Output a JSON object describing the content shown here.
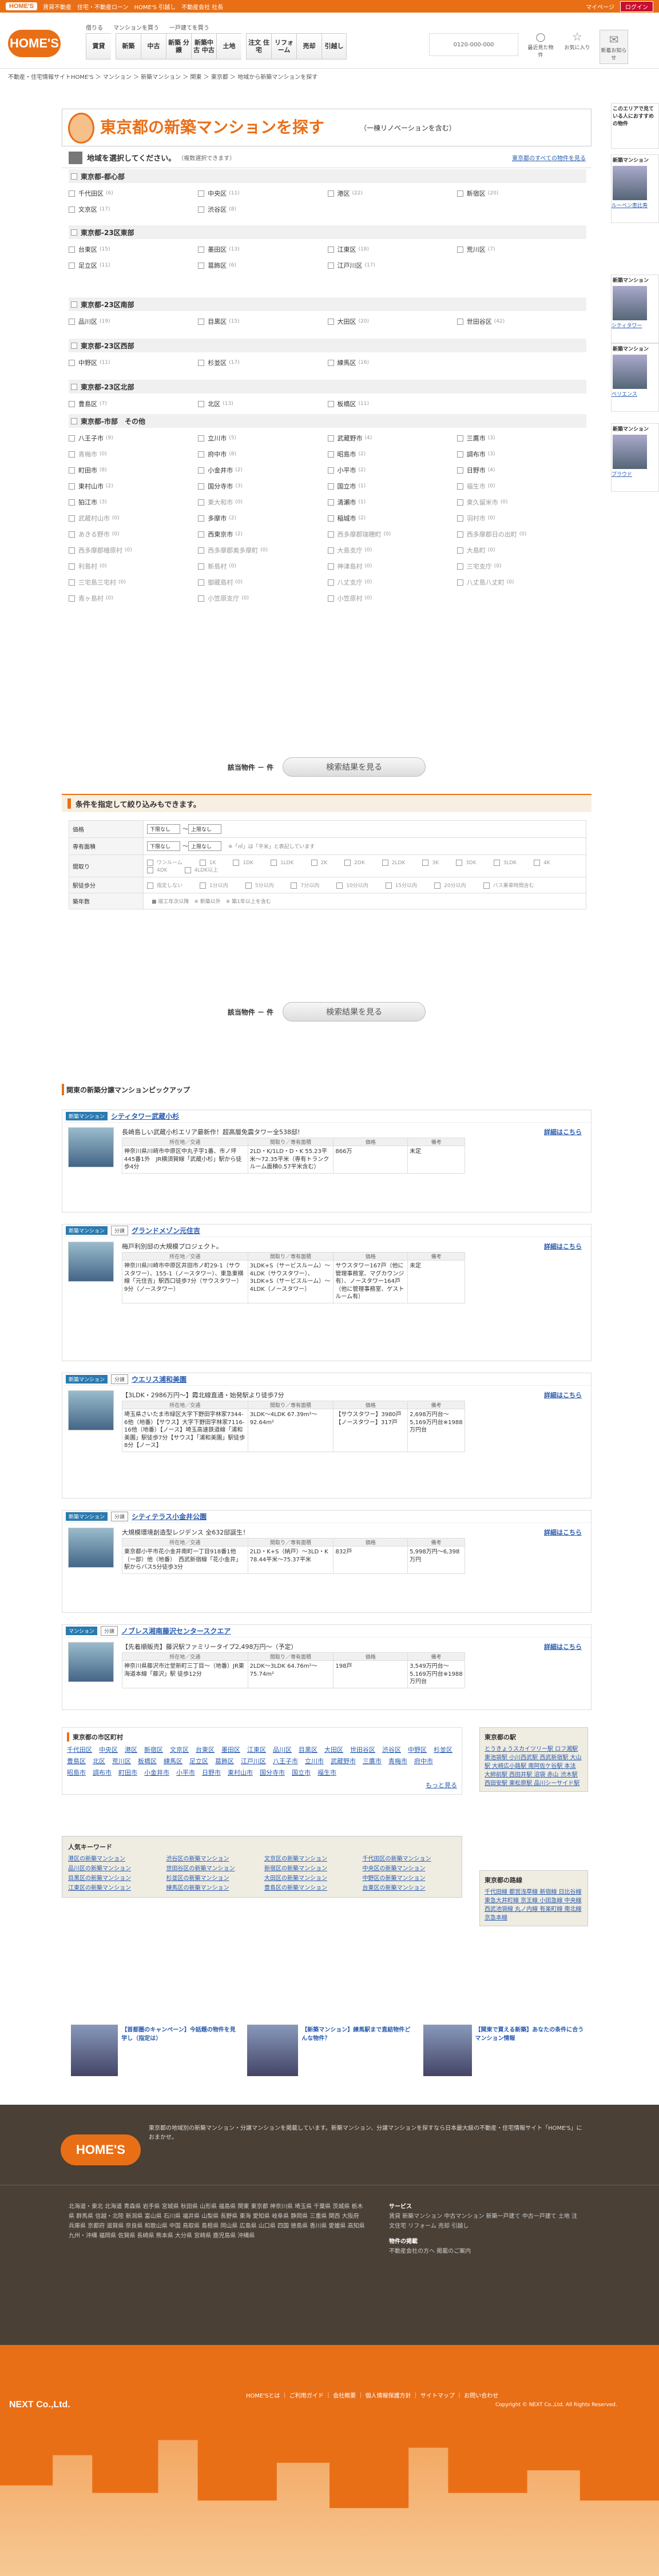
{
  "topbar": {
    "logo": "HOME'S",
    "link1": "賃貸不動産",
    "link2": "住宅・不動産ローン",
    "link3": "HOME'S 引越し",
    "link4": "不動産会社 社長",
    "right1": "マイページ",
    "right2": "ログイン"
  },
  "nav": {
    "caption1": "借りる",
    "caption2": "マンションを買う",
    "caption3": "一戸建てを買う",
    "items": [
      "賃貸",
      "新築",
      "中古",
      "新築 分譲",
      "新築中古 中古",
      "土地",
      "注文 住宅",
      "リフォーム",
      "売却",
      "引越し"
    ]
  },
  "header": {
    "phone": "0120-000-000",
    "icons": [
      {
        "name": "最近見た物件",
        "glyph": "○"
      },
      {
        "name": "お気に入り",
        "glyph": "☆"
      },
      {
        "name": "新着お知らせ",
        "glyph": "✉"
      }
    ]
  },
  "breadcrumb": "不動産・住宅情報サイトHOME'S ＞ マンション ＞ 新築マンション ＞ 関東 ＞ 東京都 ＞ 地域から新築マンションを探す",
  "title": {
    "main": "東京都の新築マンションを探す",
    "sub": "（一棟リノベーションを含む）"
  },
  "region": {
    "title": "地域を選択してください。",
    "note": "（複数選択できます）",
    "link": "東京都のすべての物件を見る"
  },
  "sections": [
    {
      "name": "東京都-都心部",
      "items": [
        {
          "n": "千代田区",
          "c": "(6)"
        },
        {
          "n": "中央区",
          "c": "(11)"
        },
        {
          "n": "港区",
          "c": "(22)"
        },
        {
          "n": "新宿区",
          "c": "(20)"
        },
        {
          "n": "文京区",
          "c": "(17)"
        },
        {
          "n": "渋谷区",
          "c": "(8)"
        }
      ]
    },
    {
      "name": "東京都-23区東部",
      "items": [
        {
          "n": "台東区",
          "c": "(15)"
        },
        {
          "n": "墨田区",
          "c": "(13)"
        },
        {
          "n": "江東区",
          "c": "(18)"
        },
        {
          "n": "荒川区",
          "c": "(7)"
        },
        {
          "n": "足立区",
          "c": "(11)"
        },
        {
          "n": "葛飾区",
          "c": "(6)"
        },
        {
          "n": "江戸川区",
          "c": "(17)"
        }
      ]
    },
    {
      "name": "東京都-23区南部",
      "items": [
        {
          "n": "品川区",
          "c": "(19)"
        },
        {
          "n": "目黒区",
          "c": "(15)"
        },
        {
          "n": "大田区",
          "c": "(20)"
        },
        {
          "n": "世田谷区",
          "c": "(42)"
        }
      ]
    },
    {
      "name": "東京都-23区西部",
      "items": [
        {
          "n": "中野区",
          "c": "(11)"
        },
        {
          "n": "杉並区",
          "c": "(17)"
        },
        {
          "n": "練馬区",
          "c": "(16)"
        }
      ]
    },
    {
      "name": "東京都-23区北部",
      "items": [
        {
          "n": "豊島区",
          "c": "(7)"
        },
        {
          "n": "北区",
          "c": "(13)"
        },
        {
          "n": "板橋区",
          "c": "(11)"
        }
      ]
    },
    {
      "name": "東京都-市部　その他",
      "items": [
        {
          "n": "八王子市",
          "c": "(9)"
        },
        {
          "n": "立川市",
          "c": "(5)"
        },
        {
          "n": "武蔵野市",
          "c": "(4)"
        },
        {
          "n": "三鷹市",
          "c": "(3)"
        },
        {
          "n": "青梅市",
          "c": "(0)",
          "d": 1
        },
        {
          "n": "府中市",
          "c": "(8)"
        },
        {
          "n": "昭島市",
          "c": "(2)"
        },
        {
          "n": "調布市",
          "c": "(3)"
        },
        {
          "n": "町田市",
          "c": "(8)"
        },
        {
          "n": "小金井市",
          "c": "(2)"
        },
        {
          "n": "小平市",
          "c": "(2)"
        },
        {
          "n": "日野市",
          "c": "(4)"
        },
        {
          "n": "東村山市",
          "c": "(2)"
        },
        {
          "n": "国分寺市",
          "c": "(3)"
        },
        {
          "n": "国立市",
          "c": "(1)"
        },
        {
          "n": "福生市",
          "c": "(0)",
          "d": 1
        },
        {
          "n": "狛江市",
          "c": "(3)"
        },
        {
          "n": "東大和市",
          "c": "(0)",
          "d": 1
        },
        {
          "n": "清瀬市",
          "c": "(1)"
        },
        {
          "n": "東久留米市",
          "c": "(0)",
          "d": 1
        },
        {
          "n": "武蔵村山市",
          "c": "(0)",
          "d": 1
        },
        {
          "n": "多摩市",
          "c": "(2)"
        },
        {
          "n": "稲城市",
          "c": "(2)"
        },
        {
          "n": "羽村市",
          "c": "(0)",
          "d": 1
        },
        {
          "n": "あきる野市",
          "c": "(0)",
          "d": 1
        },
        {
          "n": "西東京市",
          "c": "(2)"
        },
        {
          "n": "西多摩郡瑞穂町",
          "c": "(0)",
          "d": 1
        },
        {
          "n": "西多摩郡日の出町",
          "c": "(0)",
          "d": 1
        },
        {
          "n": "西多摩郡檜原村",
          "c": "(0)",
          "d": 1
        },
        {
          "n": "西多摩郡奥多摩町",
          "c": "(0)",
          "d": 1
        },
        {
          "n": "大島支庁",
          "c": "(0)",
          "d": 1
        },
        {
          "n": "大島町",
          "c": "(0)",
          "d": 1
        },
        {
          "n": "利島村",
          "c": "(0)",
          "d": 1
        },
        {
          "n": "新島村",
          "c": "(0)",
          "d": 1
        },
        {
          "n": "神津島村",
          "c": "(0)",
          "d": 1
        },
        {
          "n": "三宅支庁",
          "c": "(0)",
          "d": 1
        },
        {
          "n": "三宅島三宅村",
          "c": "(0)",
          "d": 1
        },
        {
          "n": "御蔵島村",
          "c": "(0)",
          "d": 1
        },
        {
          "n": "八丈支庁",
          "c": "(0)",
          "d": 1
        },
        {
          "n": "八丈島八丈町",
          "c": "(0)",
          "d": 1
        },
        {
          "n": "青ヶ島村",
          "c": "(0)",
          "d": 1
        },
        {
          "n": "小笠原支庁",
          "c": "(0)",
          "d": 1
        },
        {
          "n": "小笠原村",
          "c": "(0)",
          "d": 1
        }
      ]
    }
  ],
  "result": {
    "label": "該当物件 － 件",
    "button": "検索結果を見る"
  },
  "conditions": {
    "title": "条件を指定して絞り込みもできます。",
    "rows": [
      {
        "k": "価格",
        "v": [
          "下限なし",
          "〜",
          "上限なし"
        ]
      },
      {
        "k": "専有面積",
        "v": [
          "下限なし",
          "〜",
          "上限なし"
        ],
        "note": "※「㎡」は「平米」と表記しています"
      },
      {
        "k": "間取り",
        "opts": [
          "ワンルーム",
          "1K",
          "1DK",
          "1LDK",
          "2K",
          "2DK",
          "2LDK",
          "3K",
          "3DK",
          "3LDK",
          "4K",
          "4DK",
          "4LDK以上"
        ]
      },
      {
        "k": "駅徒歩分",
        "opts": [
          "指定しない",
          "1分以内",
          "5分以内",
          "7分以内",
          "10分以内",
          "15分以内",
          "20分以内",
          "バス乗車時間含む"
        ]
      },
      {
        "k": "築年数",
        "note": "■ 竣工年次以降　※ 新築以外　※ 築1年以上を含む"
      }
    ]
  },
  "pickup": {
    "title": "関東の新築分譲マンションピックアップ",
    "headers": [
      "所在地／交通",
      "間取り／専有面積",
      "価格",
      "備考"
    ],
    "more": "詳細はこちら",
    "cards": [
      {
        "tags": [
          "新築マンション"
        ],
        "name": "シティタワー武蔵小杉",
        "catch": "長崎島しい武蔵小杉エリア最新作！超高層免震タワー全538邸!",
        "addr": "神奈川県川崎市中原区中丸子字1番、市ノ坪445番1外　JR横須賀線「武蔵小杉」駅から徒歩4分",
        "plan": "2LD・K/1LD・D・K 55.23平米〜72.35平米（専有トランクルーム面積0.57平米含む）",
        "price": "866万",
        "note": "未定"
      },
      {
        "tags": [
          "新築マンション",
          "分譲"
        ],
        "name": "グランドメゾン元住吉",
        "catch": "梅戸利別邸の大規模プロジェクト。",
        "addr": "神奈川県川崎市中原区井田市ノ町29-1（サウスタワー）、155-1（ノースタワー）、東急東横線「元住吉」駅西口徒歩7分（サウスタワー）9分（ノースタワー）",
        "plan": "3LDK+S（サービスルーム）〜4LDK（サウスタワー）、3LDK+S（サービスルーム）〜4LDK（ノースタワー）",
        "price": "サウスタワー167戸（他に管理事務室、マグカウンジ有）、ノースタワー164戸（他に管理事務室、ゲストルーム有）",
        "note": "未定"
      },
      {
        "tags": [
          "新築マンション",
          "分譲"
        ],
        "name": "ウエリス浦和美園",
        "catch": "【3LDK・2986万円〜】霞北線直通・始発駅より徒歩7分",
        "addr": "埼玉県さいたま市緑区大字下野田字林家7344-6他（地番）【サウス】大字下野田字林家7116-16他（地番）【ノース】埼玉高速鉄道線「浦和美園」駅徒歩7分【サウス】「浦和美園」駅徒歩8分【ノース】",
        "plan": "3LDK〜4LDK 67.39m²〜92.64m²",
        "price": "【サウスタワー】3980戸【ノースタワー】317戸",
        "note": "2,698万円台〜5,169万円台※1988万円台"
      },
      {
        "tags": [
          "新築マンション",
          "分譲"
        ],
        "name": "シティテラス小金井公園",
        "catch": "大規模環境創造型レジデンス 全632邸誕生！",
        "addr": "東京都小平市花小金井南町一丁目918番1他（一部）他（地番）　西武新宿線「花小金井」駅からバス5分徒歩3分",
        "plan": "2LD・K+S（納戸）〜3LD・K 78.44平米〜75.37平米",
        "price": "832戸",
        "note": "5,998万円〜6,398万円"
      },
      {
        "tags": [
          "マンション",
          "分譲"
        ],
        "name": "ノブレス湘南藤沢センタースクエア",
        "catch": "【先着順販売】藤沢駅ファミリータイプ2,498万円〜（予定）",
        "addr": "神奈川県藤沢市辻堂新町三丁目〜（地番）JR東海道本線「藤沢」駅 徒歩12分",
        "plan": "2LDK〜3LDK 64.76m²〜75.74m²",
        "price": "198戸",
        "note": "3,549万円台〜5,169万円台※1988万円台"
      }
    ]
  },
  "areas": {
    "title": "東京都の市区町村",
    "items": [
      "千代田区",
      "中央区",
      "港区",
      "新宿区",
      "文京区",
      "台東区",
      "墨田区",
      "江東区",
      "品川区",
      "目黒区",
      "大田区",
      "世田谷区",
      "渋谷区",
      "中野区",
      "杉並区",
      "豊島区",
      "北区",
      "荒川区",
      "板橋区",
      "練馬区",
      "足立区",
      "葛飾区",
      "江戸川区",
      "八王子市",
      "立川市",
      "武蔵野市",
      "三鷹市",
      "青梅市",
      "府中市",
      "昭島市",
      "調布市",
      "町田市",
      "小金井市",
      "小平市",
      "日野市",
      "東村山市",
      "国分寺市",
      "国立市",
      "福生市"
    ],
    "more": "もっと見る"
  },
  "keywords": {
    "title": "人気キーワード",
    "items": [
      "港区の新築マンション",
      "渋谷区の新築マンション",
      "文京区の新築マンション",
      "千代田区の新築マンション",
      "品川区の新築マンション",
      "世田谷区の新築マンション",
      "新宿区の新築マンション",
      "中央区の新築マンション",
      "目黒区の新築マンション",
      "杉並区の新築マンション",
      "大田区の新築マンション",
      "中野区の新築マンション",
      "江東区の新築マンション",
      "練馬区の新築マンション",
      "豊島区の新築マンション",
      "台東区の新築マンション"
    ]
  },
  "side": {
    "box1": {
      "title": "東京都の駅",
      "text": "とうきょうスカイツリー駅 ロフ湘駅 東池袋駅 小川西武駅 西武新宿駅 大山駅 大崎広小路駅 南阿佐ケ谷駅 本法 大師前駅 西田井駅 沼袋 赤山 渋木駅 西田安駅 東松原駅 品川シーサイド駅"
    },
    "box2": {
      "title": "東京都の路線",
      "text": "千代田線 都営浅草線 新宿線 日比谷線 東急大井町線 京王線 小田急線 中央線 西武池袋線 丸ノ内線 有楽町線 南北線 京急本線"
    }
  },
  "rightcol": [
    {
      "title": "このエリアで見ている人におすすめの物件"
    },
    {
      "title": "新築マンション",
      "name": "ルーベン恵比寿"
    },
    {
      "title": "新築マンション",
      "name": "シティタワー"
    },
    {
      "title": "新築マンション",
      "name": "ベリエンス"
    },
    {
      "title": "新築マンション",
      "name": "プラウド"
    }
  ],
  "banners": [
    {
      "text": "【首都圏のキャンペーン】今話題の物件を見学し（指定は）"
    },
    {
      "text": "【新築マンション】練馬駅まで直結物件どんな物件？"
    },
    {
      "text": "【関東で買える新築】あなたの条件に合うマンション情報"
    }
  ],
  "footer": {
    "logo": "HOME'S",
    "desc": "東京都の地域別の新築マンション・分譲マンションを掲載しています。新築マンション、分譲マンションを探すなら日本最大級の不動産・住宅情報サイト「HOME'S」におまかせ。",
    "links": "北海道・東北 北海道 青森県 岩手県 宮城県 秋田県 山形県 福島県 関東 東京都 神奈川県 埼玉県 千葉県 茨城県 栃木県 群馬県 信越・北陸 新潟県 富山県 石川県 福井県 山梨県 長野県 東海 愛知県 岐阜県 静岡県 三重県 関西 大阪府 兵庫県 京都府 滋賀県 奈良県 和歌山県 中国 鳥取県 島根県 岡山県 広島県 山口県 四国 徳島県 香川県 愛媛県 高知県 九州・沖縄 福岡県 佐賀県 長崎県 熊本県 大分県 宮崎県 鹿児島県 沖縄県",
    "svcTitle": "サービス",
    "svc": "賃貸 新築マンション 中古マンション 新築一戸建て 中古一戸建て 土地 注文住宅 リフォーム 売却 引越し",
    "biz": "物件の掲載",
    "biztxt": "不動産会社の方へ 掲載のご案内"
  },
  "bottom": {
    "company": "NEXT Co.,Ltd.",
    "links": "HOME'Sとは ｜ ご利用ガイド ｜ 会社概要 ｜ 個人情報保護方針 ｜ サイトマップ ｜ お問い合わせ",
    "copy": "Copyright © NEXT Co.,Ltd. All Rights Reserved."
  }
}
